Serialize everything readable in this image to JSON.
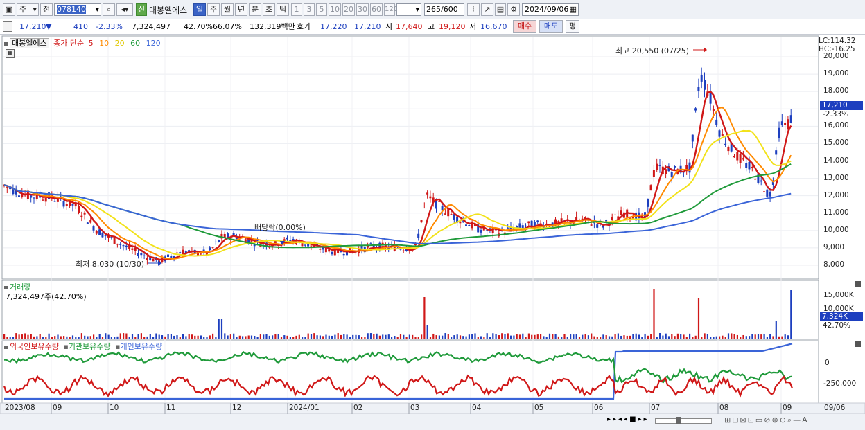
{
  "toolbar": {
    "type_select": "주",
    "prev_label": "전",
    "code_value": "078140",
    "stock_badge": "신",
    "stock_name": "대봉엘에스",
    "periods": [
      "일",
      "주",
      "월",
      "년",
      "분",
      "초",
      "틱"
    ],
    "active_period": "일",
    "minute_options": [
      "1",
      "3",
      "5",
      "10",
      "20",
      "30",
      "60",
      "120"
    ],
    "count_value": "265",
    "count_total": "/600",
    "date_value": "2024/09/06"
  },
  "quote": {
    "price": "17,210",
    "change": "410",
    "change_pct": "-2.33%",
    "volume": "7,324,497",
    "vol_pct": "42.70%",
    "ratio": "66.07%",
    "amount": "132,319백만",
    "ask_label": "호가",
    "ask": "17,220",
    "bid": "17,210",
    "open_label": "시",
    "open": "17,640",
    "high_label": "고",
    "high": "19,120",
    "low_label": "저",
    "low": "16,670",
    "buy_label": "매수",
    "sell_label": "매도",
    "eval_label": "평"
  },
  "price_panel": {
    "stock_tag": "대봉엘에스",
    "legend_prefix": "종가 단순",
    "ma_labels": [
      "5",
      "10",
      "20",
      "60",
      "120"
    ],
    "ma_colors": [
      "#d01818",
      "#ff8a00",
      "#f2e21a",
      "#1f9a3a",
      "#3a64d8"
    ],
    "lc": "LC:114.32",
    "hc": "HC:-16.25",
    "high_annotation": "최고 20,550 (07/25)",
    "low_annotation": "최저 8,030 (10/30)",
    "dividend_annotation": "배당락(0.00%)",
    "last_price": "17,210",
    "last_pct": "-2.33%",
    "y_ticks": [
      "20,000",
      "19,000",
      "18,000",
      "17,000",
      "16,000",
      "15,000",
      "14,000",
      "13,000",
      "12,000",
      "11,000",
      "10,000",
      "9,000",
      "8,000"
    ]
  },
  "volume_panel": {
    "title": "거래량",
    "value_text": "7,324,497주(42.70%)",
    "y_ticks": [
      "15,000K",
      "10,000K"
    ],
    "last_value": "7,324K",
    "last_pct": "42.70%"
  },
  "holding_panel": {
    "legend": [
      "외국인보유수량",
      "기관보유수량",
      "개인보유수량"
    ],
    "colors": [
      "#d01818",
      "#1f9a3a",
      "#3a64d8"
    ],
    "y_ticks": [
      "0",
      "-250,000"
    ]
  },
  "x_axis": {
    "labels": [
      "2023/08",
      "09",
      "10",
      "11",
      "12",
      "2024/01",
      "02",
      "03",
      "04",
      "05",
      "06",
      "07",
      "08",
      "09",
      "09/06"
    ]
  }
}
